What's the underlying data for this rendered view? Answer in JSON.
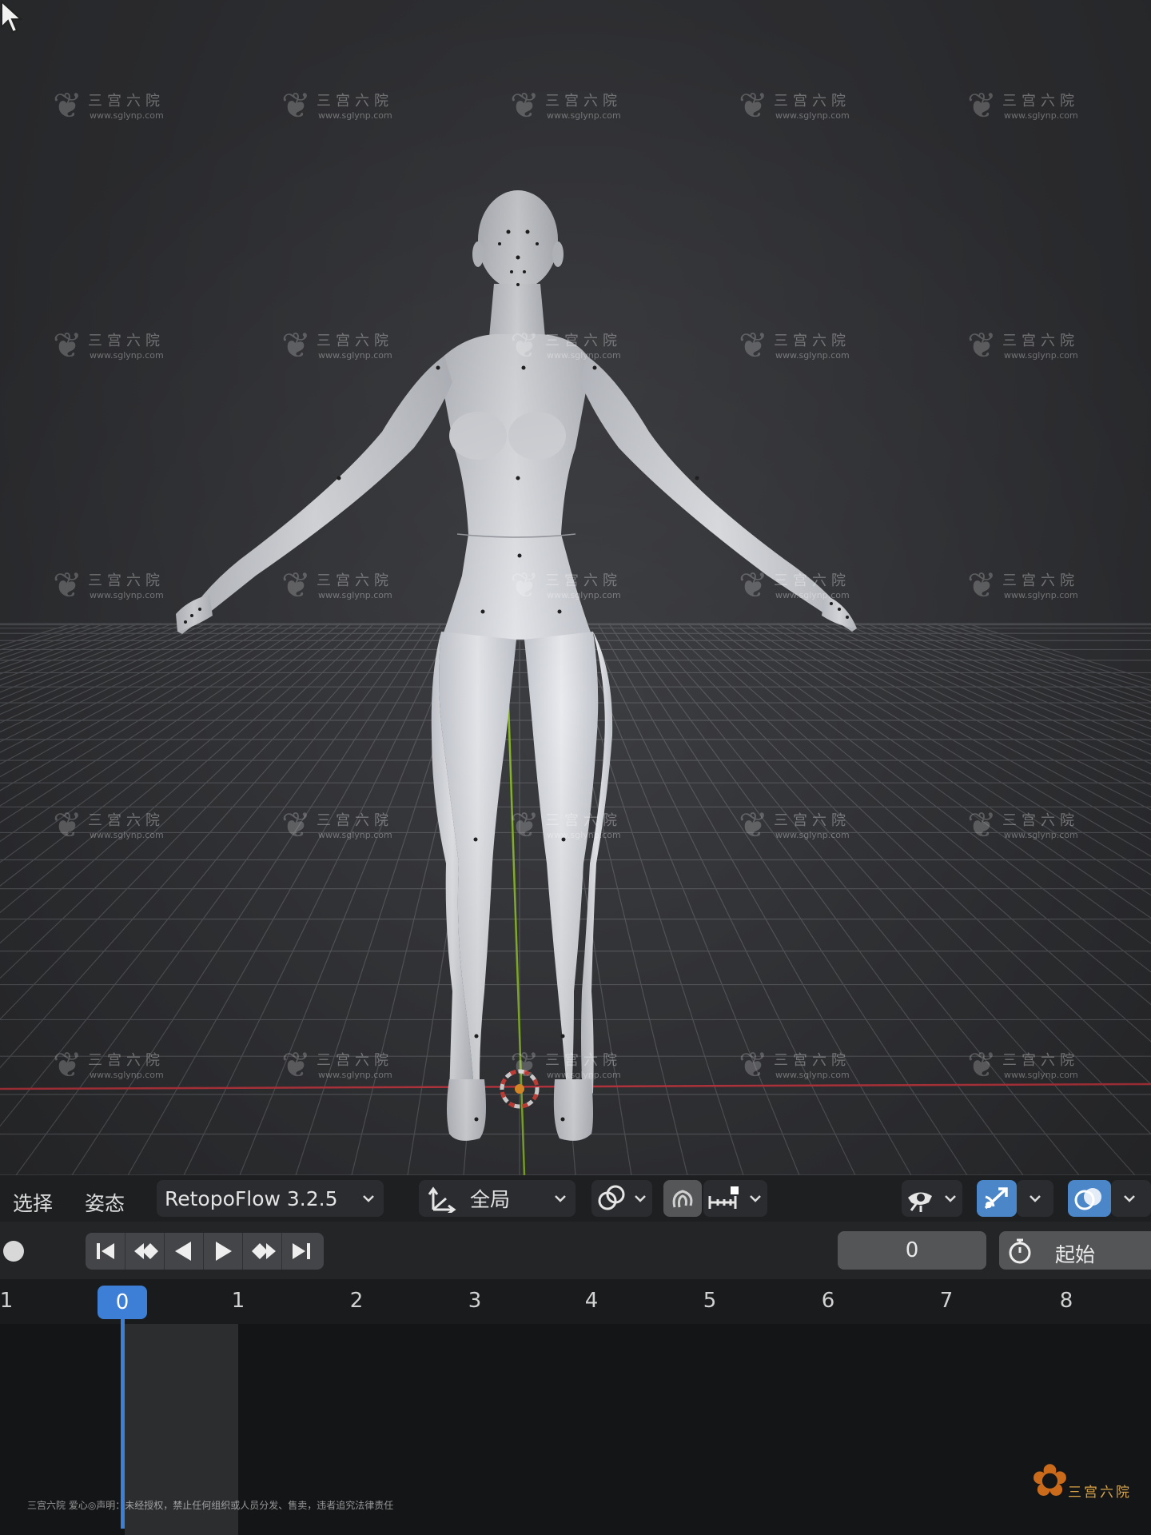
{
  "viewport": {
    "axis_colors": {
      "x_axis": "#c83a44",
      "y_axis": "#8ab82a"
    },
    "model": "human-base-mesh",
    "cursor_icon": "arrow-cursor-icon"
  },
  "header": {
    "menu_select": "选择",
    "menu_pose": "姿态",
    "addon_dropdown": "RetopoFlow 3.2.5",
    "transform_orientation": "全局",
    "icons": [
      "transform-orientation-icon",
      "pivot-link-icon",
      "snap-magnet-icon",
      "snap-increment-icon",
      "visibility-icon",
      "gizmo-toggle-icon",
      "overlay-toggle-icon"
    ]
  },
  "playback": {
    "current_frame_value": "0",
    "start_label": "起始",
    "buttons": [
      "jump-start-icon",
      "prev-keyframe-icon",
      "play-reverse-icon",
      "play-icon",
      "next-keyframe-icon",
      "jump-end-icon"
    ]
  },
  "timeline": {
    "ruler_labels": [
      "1",
      "1",
      "2",
      "3",
      "4",
      "5",
      "6",
      "7",
      "8"
    ],
    "current_frame": "0",
    "accent": "#3d7fd6"
  },
  "watermark": {
    "name": "三宫六院",
    "url": "www.sglynp.com",
    "footer": "三宫六院 爱心◎声明：未经授权，禁止任何组织或人员分发、售卖，违者追究法律责任"
  }
}
